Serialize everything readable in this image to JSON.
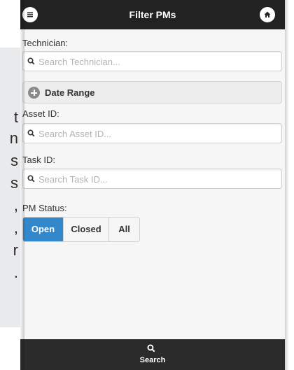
{
  "background_text": [
    "t",
    "n",
    "s",
    "s",
    ",",
    ",",
    "r",
    "."
  ],
  "header": {
    "title": "Filter PMs",
    "left_icon": "menu-icon",
    "right_icon": "home-icon"
  },
  "form": {
    "technician": {
      "label": "Technician:",
      "placeholder": "Search Technician..."
    },
    "date_range": {
      "label": "Date Range",
      "icon": "plus-circle-icon",
      "collapsed": true
    },
    "asset": {
      "label": "Asset ID:",
      "placeholder": "Search Asset ID..."
    },
    "task": {
      "label": "Task ID:",
      "placeholder": "Search Task ID..."
    },
    "pm_status": {
      "label": "PM Status:",
      "options": [
        "Open",
        "Closed",
        "All"
      ],
      "selected": "Open"
    }
  },
  "footer": {
    "label": "Search",
    "icon": "search-icon"
  },
  "colors": {
    "header_bg": "#222222",
    "active": "#3388cc",
    "footer_bg": "#2b2b2b",
    "page_bg": "#f6f6f6"
  }
}
